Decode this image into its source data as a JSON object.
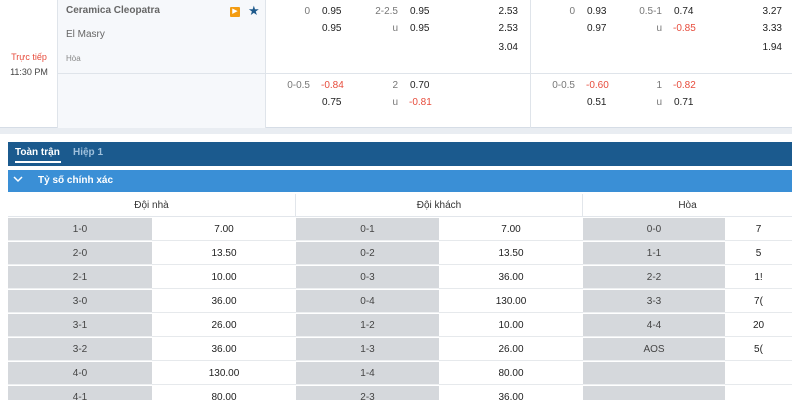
{
  "match": {
    "status": "Trực tiếp",
    "time": "11:30 PM",
    "home": "Ceramica Cleopatra",
    "away": "El Masry",
    "draw_label": "Hòa",
    "flag_icon": "tv-icon",
    "star_icon": "star-icon",
    "ft": {
      "row1": {
        "hdp_line": "0",
        "hdp_home": "0.95",
        "hdp_away": "0.95",
        "ou_line": "2-2.5",
        "ou_over": "0.95",
        "ou_u": "u",
        "ou_under": "0.95",
        "x12_home": "2.53",
        "x12_away": "2.53",
        "x12_draw": "3.04"
      },
      "row2": {
        "hdp_line": "0-0.5",
        "hdp_home": "-0.84",
        "hdp_away": "0.75",
        "ou_line": "2",
        "ou_over": "0.70",
        "ou_u": "u",
        "ou_under": "-0.81"
      }
    },
    "h1": {
      "row1": {
        "hdp_line": "0",
        "hdp_home": "0.93",
        "hdp_away": "0.97",
        "ou_line": "0.5-1",
        "ou_over": "0.74",
        "ou_u": "u",
        "ou_under": "-0.85",
        "x12_home": "3.27",
        "x12_away": "3.33",
        "x12_draw": "1.94"
      },
      "row2": {
        "hdp_line": "0-0.5",
        "hdp_home": "-0.60",
        "hdp_away": "0.51",
        "ou_line": "1",
        "ou_over": "-0.82",
        "ou_u": "u",
        "ou_under": "0.71"
      }
    }
  },
  "tabs": [
    "Toàn trận",
    "Hiệp 1"
  ],
  "section": {
    "title": "Tỷ số chính xác",
    "icon": "chevron-down-icon"
  },
  "columns": [
    "Đội nhà",
    "Đội khách",
    "Hòa"
  ],
  "home_rows": [
    {
      "score": "1-0",
      "odds": "7.00"
    },
    {
      "score": "2-0",
      "odds": "13.50"
    },
    {
      "score": "2-1",
      "odds": "10.00"
    },
    {
      "score": "3-0",
      "odds": "36.00"
    },
    {
      "score": "3-1",
      "odds": "26.00"
    },
    {
      "score": "3-2",
      "odds": "36.00"
    },
    {
      "score": "4-0",
      "odds": "130.00"
    },
    {
      "score": "4-1",
      "odds": "80.00"
    }
  ],
  "away_rows": [
    {
      "score": "0-1",
      "odds": "7.00"
    },
    {
      "score": "0-2",
      "odds": "13.50"
    },
    {
      "score": "0-3",
      "odds": "36.00"
    },
    {
      "score": "0-4",
      "odds": "130.00"
    },
    {
      "score": "1-2",
      "odds": "10.00"
    },
    {
      "score": "1-3",
      "odds": "26.00"
    },
    {
      "score": "1-4",
      "odds": "80.00"
    },
    {
      "score": "2-3",
      "odds": "36.00"
    }
  ],
  "draw_rows": [
    {
      "score": "0-0",
      "odds": "7"
    },
    {
      "score": "1-1",
      "odds": "5"
    },
    {
      "score": "2-2",
      "odds": "1!"
    },
    {
      "score": "3-3",
      "odds": "7("
    },
    {
      "score": "4-4",
      "odds": "20"
    },
    {
      "score": "AOS",
      "odds": "5("
    },
    {
      "score": "",
      "odds": ""
    },
    {
      "score": "",
      "odds": ""
    }
  ]
}
